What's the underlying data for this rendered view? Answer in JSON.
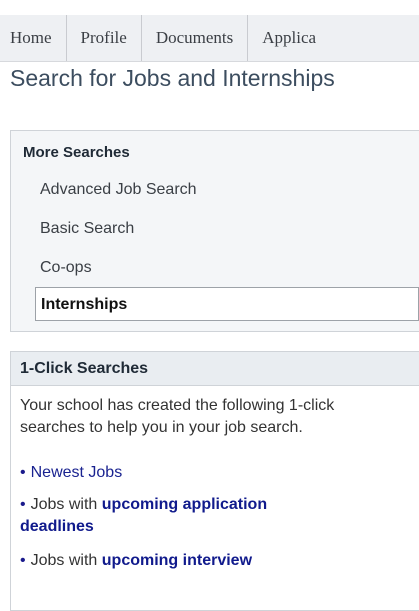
{
  "tabs": [
    "Home",
    "Profile",
    "Documents",
    "Applica"
  ],
  "page_title": "Search for Jobs and Internships",
  "more_searches": {
    "title": "More Searches",
    "items": [
      "Advanced Job Search",
      "Basic Search",
      "Co-ops",
      "Internships"
    ],
    "active_index": 3
  },
  "one_click": {
    "title": "1-Click Searches",
    "description": "Your school has created the following 1-click searches to help you in your job search.",
    "links": [
      {
        "bullet": "•",
        "link_text": "Newest Jobs"
      },
      {
        "bullet": "•",
        "prefix": "Jobs with",
        "link_text": "upcoming application",
        "link_text_2": "deadlines"
      },
      {
        "bullet": "•",
        "prefix": "Jobs with",
        "link_text": "upcoming interview"
      }
    ]
  }
}
